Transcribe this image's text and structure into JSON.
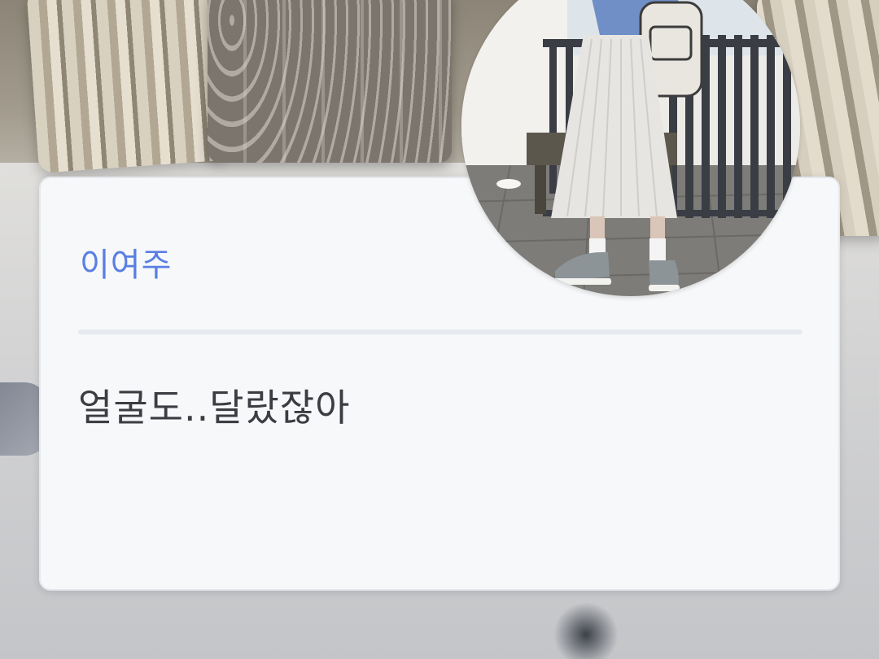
{
  "dialog": {
    "speaker_name": "이여주",
    "message": "얼굴도..달랐잖아"
  },
  "portrait": {
    "icon": "character-portrait",
    "description_icon": "portrait-photo-icon"
  },
  "colors": {
    "speaker": "#5a7fe3",
    "text": "#3b3d42",
    "card_bg": "#f6f8fa",
    "divider": "#e6e9ef"
  }
}
